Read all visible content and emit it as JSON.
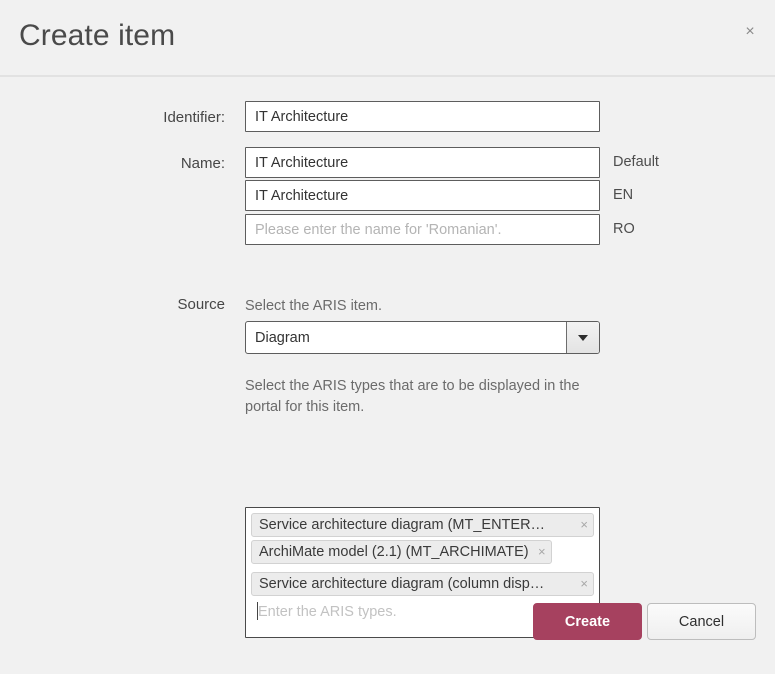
{
  "dialog": {
    "title": "Create item",
    "close_icon": "close-icon",
    "close_label": "×"
  },
  "form": {
    "identifier": {
      "label": "Identifier:",
      "value": "IT Architecture",
      "placeholder": ""
    },
    "name": {
      "label": "Name:",
      "rows": [
        {
          "value": "IT Architecture",
          "placeholder": "",
          "lang": "Default"
        },
        {
          "value": "IT Architecture",
          "placeholder": "",
          "lang": "EN"
        },
        {
          "value": "",
          "placeholder": "Please enter the name for 'Romanian'.",
          "lang": "RO"
        }
      ]
    },
    "source": {
      "label": "Source",
      "item_hint": "Select the ARIS item.",
      "selected_item": "Diagram",
      "dropdown_icon": "chevron-down-icon",
      "types_hint": "Select the ARIS types that are to be displayed in the portal for this item.",
      "tags": [
        {
          "label": "Service architecture diagram (MT_ENTER…",
          "remove_label": "×",
          "fit": false
        },
        {
          "label": "ArchiMate model (2.1) (MT_ARCHIMATE)",
          "remove_label": "×",
          "fit": true
        },
        {
          "label": "Service architecture diagram (column disp…",
          "remove_label": "×",
          "fit": false
        }
      ],
      "tags_placeholder": "Enter the ARIS types."
    }
  },
  "footer": {
    "create_label": "Create",
    "cancel_label": "Cancel"
  },
  "colors": {
    "background": "#f1f1f1",
    "primary_button": "#a6415f",
    "text": "#3c3c3c",
    "placeholder": "#b4b4b4"
  }
}
